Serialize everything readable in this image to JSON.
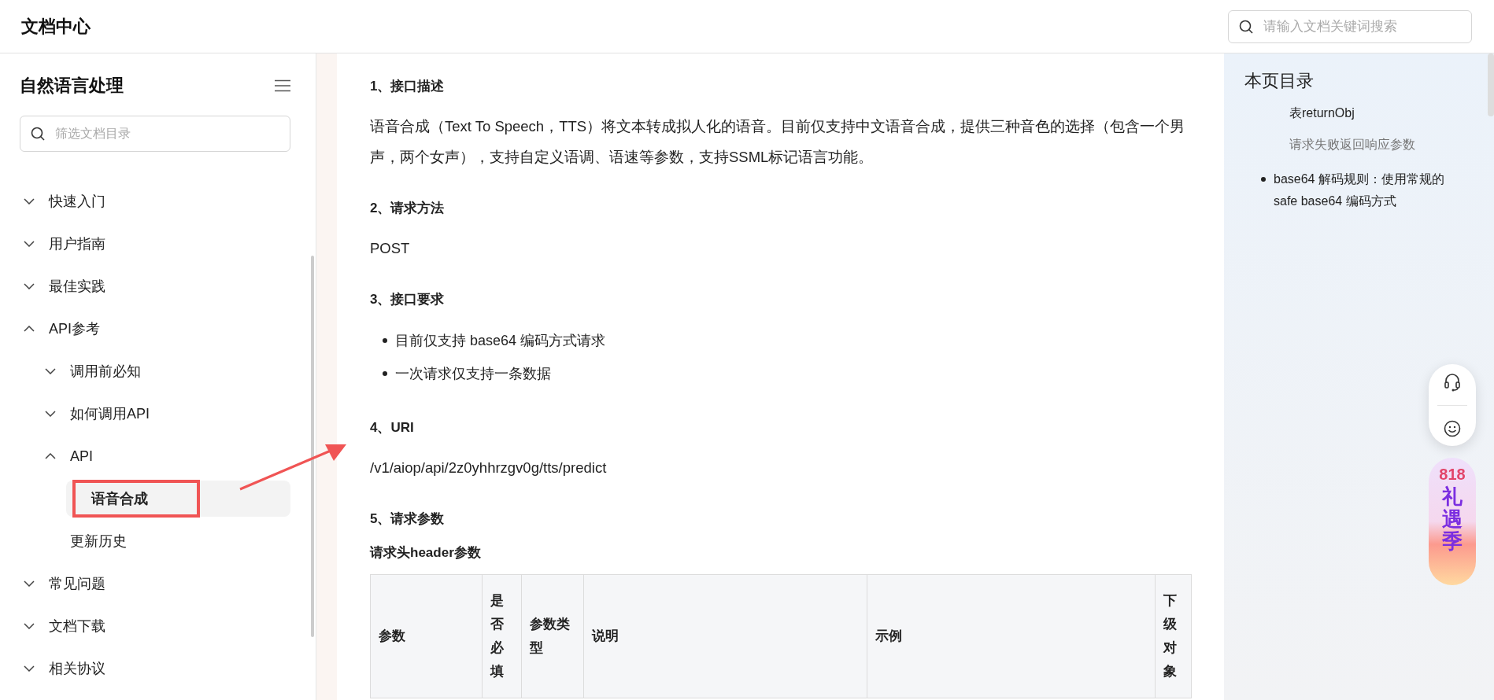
{
  "header": {
    "title": "文档中心",
    "search": {
      "placeholder": "请输入文档关键词搜索"
    }
  },
  "sidebar": {
    "title": "自然语言处理",
    "filter": {
      "placeholder": "筛选文档目录"
    },
    "items": [
      {
        "label": "快速入门",
        "expanded": false,
        "selected": false
      },
      {
        "label": "用户指南",
        "expanded": false,
        "selected": false
      },
      {
        "label": "最佳实践",
        "expanded": false,
        "selected": false
      },
      {
        "label": "API参考",
        "expanded": true,
        "selected": false,
        "children": [
          {
            "label": "调用前必知",
            "expanded": false,
            "selected": false
          },
          {
            "label": "如何调用API",
            "expanded": false,
            "selected": false
          },
          {
            "label": "API",
            "expanded": true,
            "selected": false,
            "children": [
              {
                "label": "语音合成",
                "selected": true
              }
            ]
          },
          {
            "label": "更新历史",
            "selected": false
          }
        ]
      },
      {
        "label": "常见问题",
        "expanded": false,
        "selected": false
      },
      {
        "label": "文档下载",
        "expanded": false,
        "selected": false
      },
      {
        "label": "相关协议",
        "expanded": false,
        "selected": false
      }
    ]
  },
  "content": {
    "blocks": [
      {
        "kind": "heading",
        "text": "1、接口描述"
      },
      {
        "kind": "paragraph",
        "text": "语音合成（Text To Speech，TTS）将文本转成拟人化的语音。目前仅支持中文语音合成，提供三种音色的选择（包含一个男声，两个女声），支持自定义语调、语速等参数，支持SSML标记语言功能。"
      },
      {
        "kind": "heading",
        "text": "2、请求方法"
      },
      {
        "kind": "paragraph",
        "text": "POST"
      },
      {
        "kind": "heading",
        "text": "3、接口要求"
      },
      {
        "kind": "list",
        "items": [
          "目前仅支持 base64 编码方式请求",
          "一次请求仅支持一条数据"
        ]
      },
      {
        "kind": "heading",
        "text": "4、URI"
      },
      {
        "kind": "paragraph",
        "text": "/v1/aiop/api/2z0yhhrzgv0g/tts/predict"
      },
      {
        "kind": "heading",
        "text": "5、请求参数"
      },
      {
        "kind": "subheading",
        "text": "请求头header参数"
      },
      {
        "kind": "table",
        "columns": [
          "参数",
          "是否必填",
          "参数类型",
          "说明",
          "示例",
          "下级对象"
        ]
      }
    ]
  },
  "toc": {
    "title": "本页目录",
    "items": [
      {
        "kind": "sub",
        "text": "表returnObj",
        "active": true
      },
      {
        "kind": "sub",
        "text": "请求失败返回响应参数",
        "active": false
      },
      {
        "kind": "bullet",
        "text": "base64 解码规则：使用常规的 safe base64 编码方式",
        "active": true
      }
    ]
  },
  "promo": {
    "number": "818",
    "text": "礼遇季"
  }
}
